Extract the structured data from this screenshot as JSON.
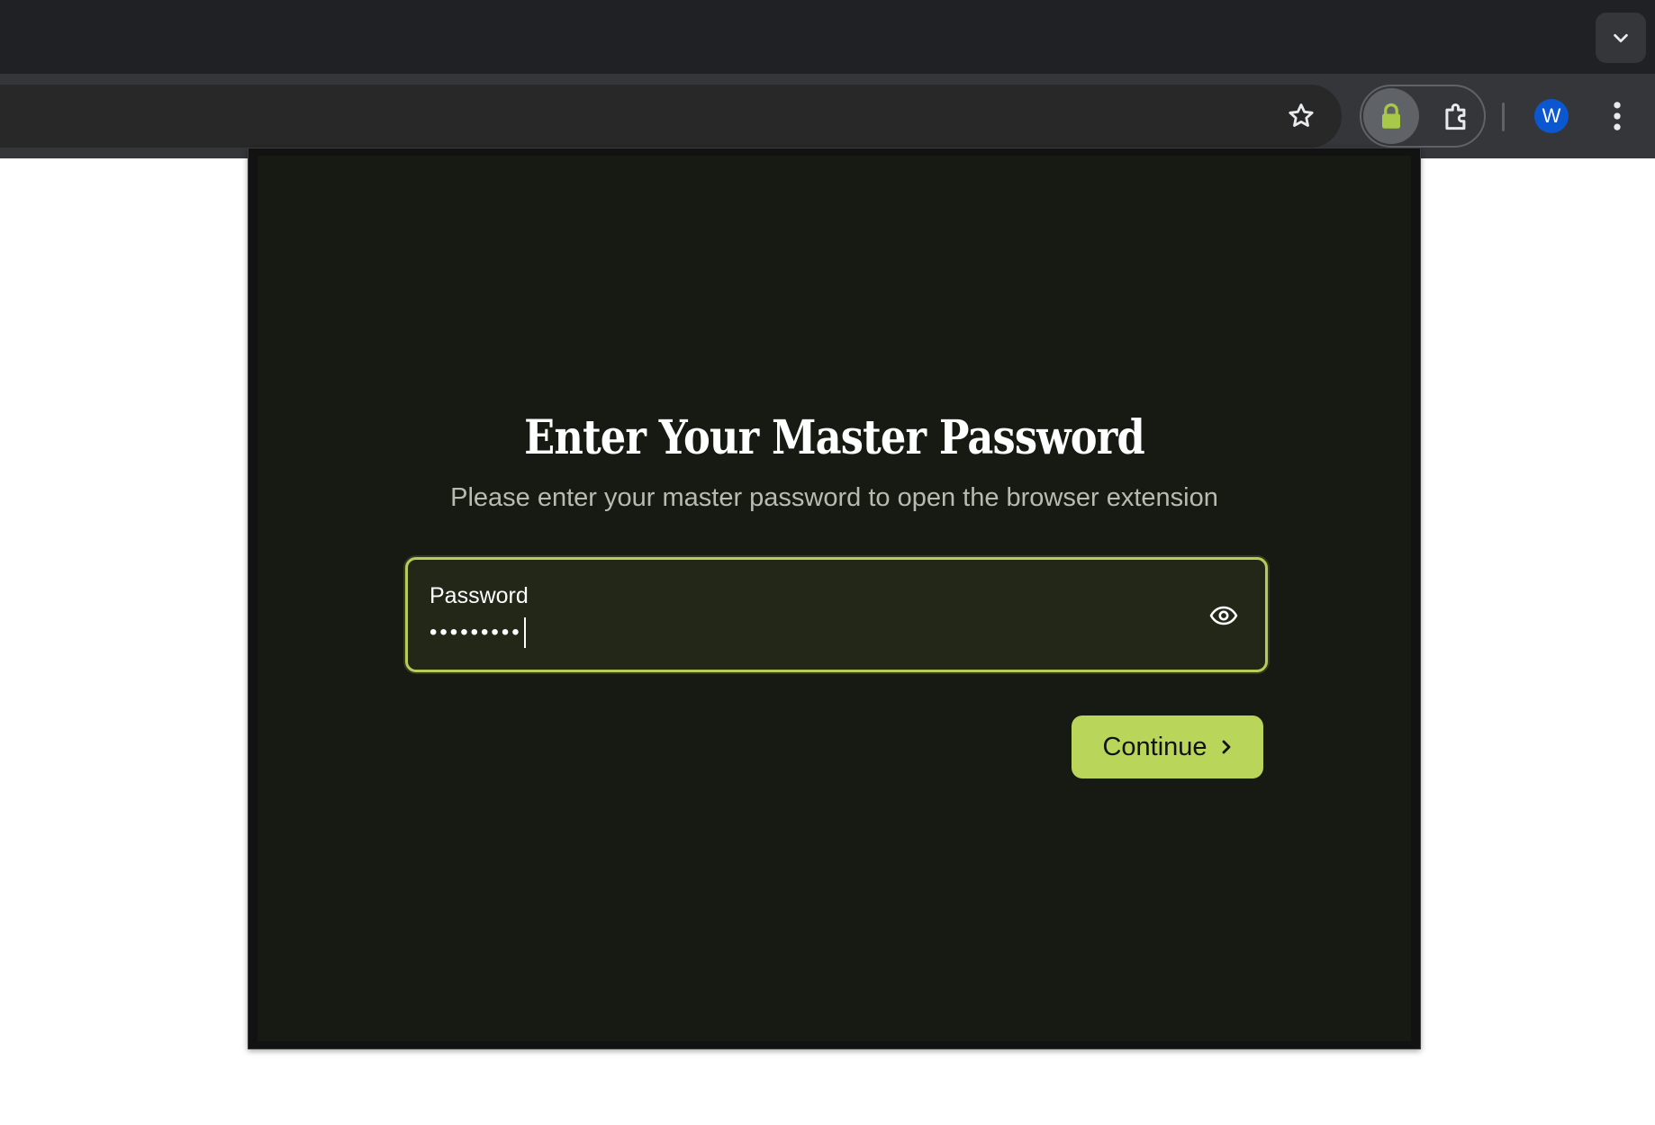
{
  "browser": {
    "avatar_initial": "W",
    "icons": {
      "tab_search": "chevron-down-icon",
      "bookmark": "star-icon",
      "extension": "lock-icon",
      "extensions_menu": "puzzle-icon",
      "menu": "more-vert-icon"
    }
  },
  "popup": {
    "title": "Enter Your Master Password",
    "subtitle": "Please enter your master password to open the browser extension",
    "password_field": {
      "label": "Password",
      "masked_value": "•••••••••",
      "toggle_icon": "eye-icon"
    },
    "continue_label": "Continue"
  },
  "colors": {
    "accent": "#bad65a",
    "popup_bg": "#171a12",
    "field_bg": "#232718"
  }
}
